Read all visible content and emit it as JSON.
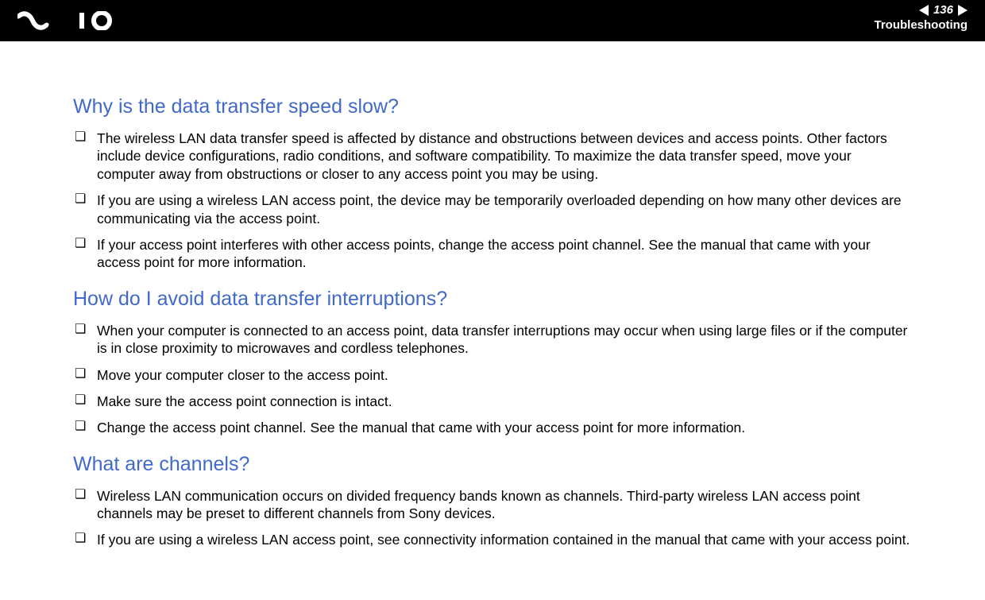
{
  "header": {
    "page_number": "136",
    "section": "Troubleshooting"
  },
  "sections": [
    {
      "title": "Why is the data transfer speed slow?",
      "items": [
        "The wireless LAN data transfer speed is affected by distance and obstructions between devices and access points. Other factors include device configurations, radio conditions, and software compatibility. To maximize the data transfer speed, move your computer away from obstructions or closer to any access point you may be using.",
        "If you are using a wireless LAN access point, the device may be temporarily overloaded depending on how many other devices are communicating via the access point.",
        "If your access point interferes with other access points, change the access point channel. See the manual that came with your access point for more information."
      ]
    },
    {
      "title": "How do I avoid data transfer interruptions?",
      "items": [
        "When your computer is connected to an access point, data transfer interruptions may occur when using large files or if the computer is in close proximity to microwaves and cordless telephones.",
        "Move your computer closer to the access point.",
        "Make sure the access point connection is intact.",
        "Change the access point channel. See the manual that came with your access point for more information."
      ]
    },
    {
      "title": "What are channels?",
      "items": [
        "Wireless LAN communication occurs on divided frequency bands known as channels. Third-party wireless LAN access point channels may be preset to different channels from Sony devices.",
        "If you are using a wireless LAN access point, see connectivity information contained in the manual that came with your access point."
      ]
    }
  ]
}
